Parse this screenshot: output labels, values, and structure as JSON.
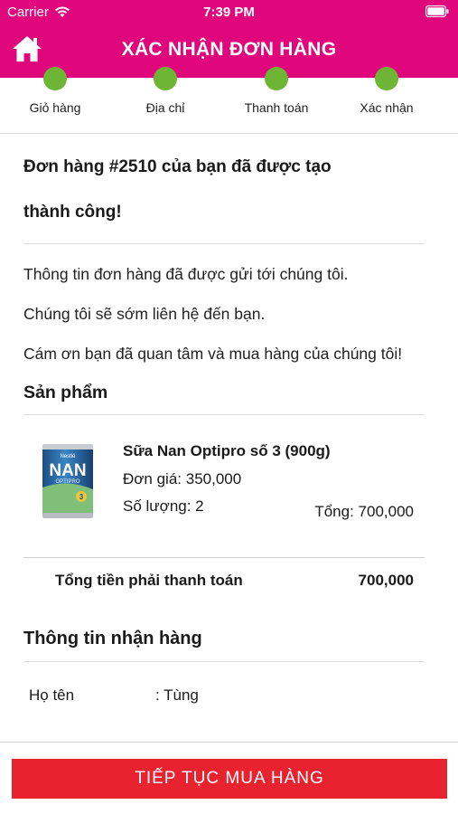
{
  "status_bar": {
    "carrier": "Carrier",
    "time": "7:39 PM"
  },
  "header": {
    "title": "XÁC NHẬN ĐƠN HÀNG",
    "color": "#e0077d"
  },
  "steps": [
    {
      "label": "Giỏ hàng"
    },
    {
      "label": "Địa chỉ"
    },
    {
      "label": "Thanh toán"
    },
    {
      "label": "Xác nhận"
    }
  ],
  "order": {
    "headline_line1": "Đơn hàng #2510 của bạn đã được tạo",
    "headline_line2": "thành công!",
    "message1": "Thông tin đơn hàng đã được gửi tới chúng tôi.",
    "message2": "Chúng tôi sẽ sớm liên hệ đến bạn.",
    "message3": "Cám ơn bạn đã quan tâm và mua hàng của chúng tôi!"
  },
  "products_section": {
    "title": "Sản phẩm",
    "items": [
      {
        "name": "Sữa Nan Optipro số 3 (900g)",
        "unit_price": "Đơn giá: 350,000",
        "quantity": "Số lượng: 2",
        "subtotal": "Tổng: 700,000",
        "image_brand": "NAN",
        "image_sub": "OPTIPRO",
        "image_top": "Nestlé"
      }
    ]
  },
  "total": {
    "label": "Tổng tiền phải thanh toán",
    "value": "700,000"
  },
  "recipient": {
    "title": "Thông tin nhận hàng",
    "rows": [
      {
        "key": "Họ tên",
        "value": ": Tùng"
      }
    ]
  },
  "cta": {
    "label": "TIẾP TỤC MUA HÀNG",
    "color": "#e8222e"
  }
}
